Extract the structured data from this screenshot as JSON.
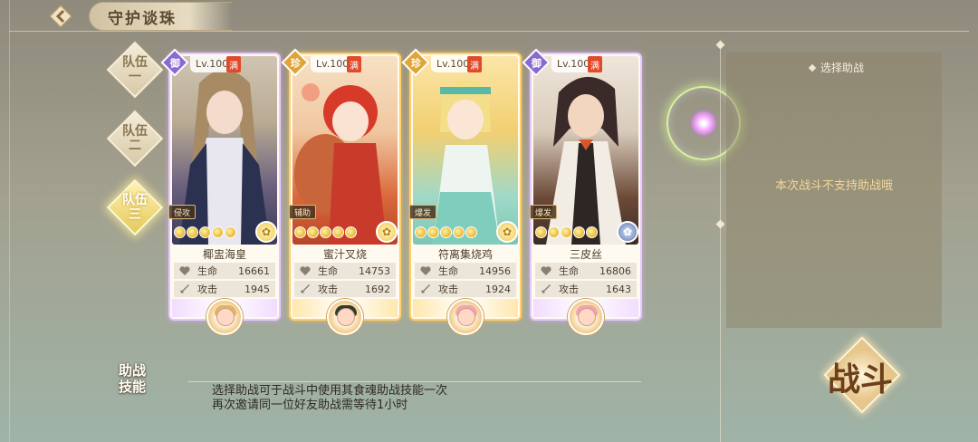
{
  "header": {
    "title": "守护谈珠"
  },
  "teams": [
    {
      "label_top": "队伍",
      "label_bottom": "一",
      "active": false
    },
    {
      "label_top": "队伍",
      "label_bottom": "二",
      "active": false
    },
    {
      "label_top": "队伍",
      "label_bottom": "三",
      "active": true
    }
  ],
  "cards": [
    {
      "rarity": "御",
      "rarity_color": "#8a6ad0",
      "level": "Lv.100",
      "max": "满",
      "type": "侵攻",
      "name": "椰盅海皇",
      "hp_label": "生命",
      "hp": "16661",
      "atk_label": "攻击",
      "atk": "1945",
      "elem": "gold",
      "frame": "purple",
      "stars": 5
    },
    {
      "rarity": "珍",
      "rarity_color": "#e0a53a",
      "level": "Lv.100",
      "max": "满",
      "type": "辅助",
      "name": "蜜汁叉烧",
      "hp_label": "生命",
      "hp": "14753",
      "atk_label": "攻击",
      "atk": "1692",
      "elem": "gold",
      "frame": "orange",
      "stars": 5
    },
    {
      "rarity": "珍",
      "rarity_color": "#e0a53a",
      "level": "Lv.100",
      "max": "满",
      "type": "爆发",
      "name": "符离集烧鸡",
      "hp_label": "生命",
      "hp": "14956",
      "atk_label": "攻击",
      "atk": "1924",
      "elem": "gold",
      "frame": "orange",
      "stars": 5
    },
    {
      "rarity": "御",
      "rarity_color": "#8a6ad0",
      "level": "Lv.100",
      "max": "满",
      "type": "爆发",
      "name": "三皮丝",
      "hp_label": "生命",
      "hp": "16806",
      "atk_label": "攻击",
      "atk": "1643",
      "elem": "blue",
      "frame": "purple",
      "stars": 5
    }
  ],
  "support": {
    "title": "选择助战",
    "message": "本次战斗不支持助战哦"
  },
  "skill": {
    "label_top": "助战",
    "label_bottom": "技能",
    "line1": "选择助战可于战斗中使用其食魂助战技能一次",
    "line2": "再次邀请同一位好友助战需等待1小时"
  },
  "fight_button": {
    "label": "战斗"
  },
  "icons": {
    "back": "back-arrow-icon",
    "heart": "heart-icon",
    "sword": "sword-icon",
    "flower": "flower-icon"
  }
}
